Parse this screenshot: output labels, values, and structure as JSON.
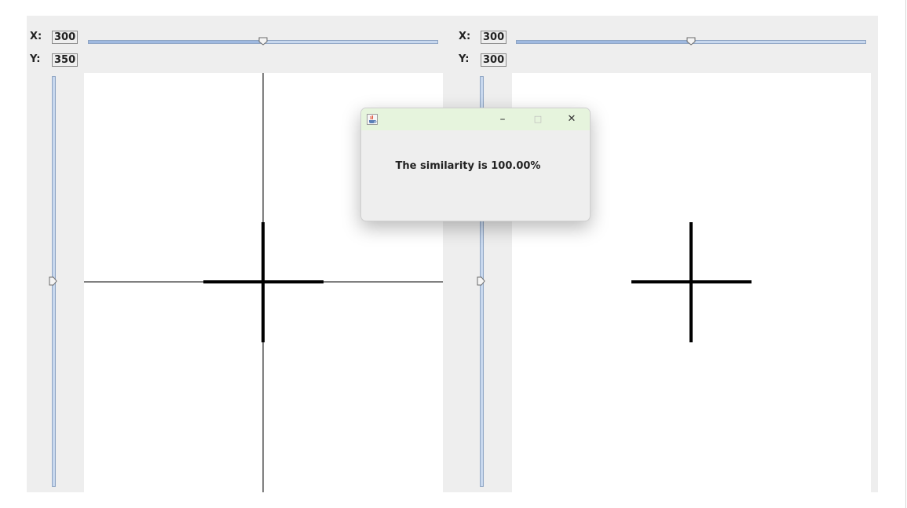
{
  "left_panel": {
    "x_label": "X:",
    "x_value": "300",
    "y_label": "Y:",
    "y_value": "350",
    "h_slider_fraction": 0.5,
    "v_slider_fraction": 0.5
  },
  "right_panel": {
    "x_label": "X:",
    "x_value": "300",
    "y_label": "Y:",
    "y_value": "300",
    "h_slider_fraction": 0.5,
    "v_slider_fraction": 0.5
  },
  "dialog": {
    "icon": "java-cup-icon",
    "minimize_glyph": "–",
    "maximize_glyph": "□",
    "close_glyph": "✕",
    "message": "The similarity is 100.00%"
  },
  "colors": {
    "panel_bg": "#eeeeee",
    "canvas_bg": "#ffffff",
    "slider_track": "#c8d8ee",
    "dialog_titlebar": "#e6f4dd"
  }
}
